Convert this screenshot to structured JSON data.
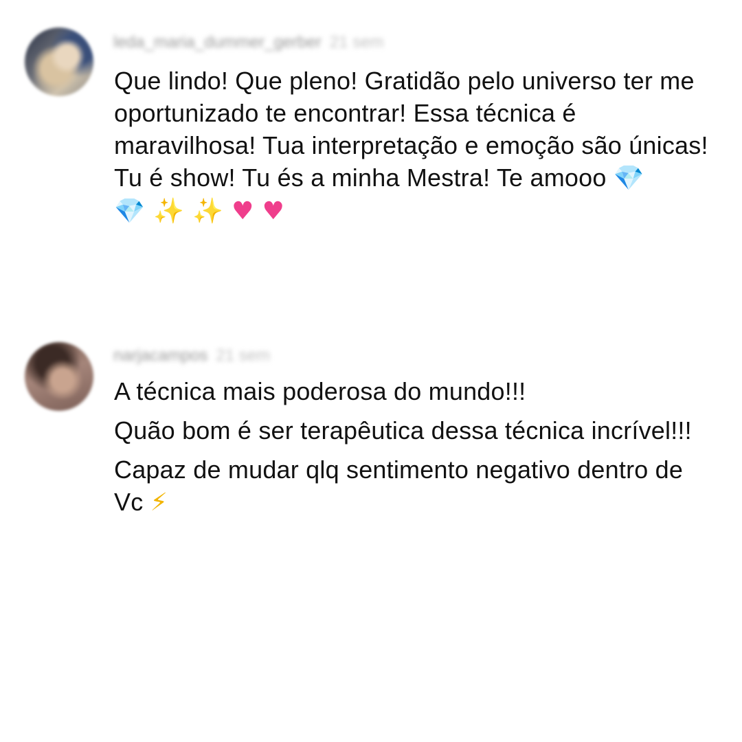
{
  "comments": [
    {
      "username": "leda_maria_dummer_gerber",
      "time": "21 sem",
      "text": "Que lindo! Que pleno! Gratidão pelo universo ter me oportunizado te encontrar! Essa técnica é maravilhosa! Tua interpretação e emoção são únicas! Tu é show! Tu és a minha Mestra! Te amooo",
      "emojis": [
        {
          "glyph": "💎",
          "icon": "gem-icon"
        },
        {
          "glyph": "💎",
          "icon": "gem-icon"
        },
        {
          "glyph": "✨",
          "icon": "sparkles-icon"
        },
        {
          "glyph": "✨",
          "icon": "sparkles-icon"
        },
        {
          "glyph": "♥",
          "icon": "pink-heart-icon"
        },
        {
          "glyph": "♥",
          "icon": "pink-heart-icon"
        }
      ]
    },
    {
      "username": "narjacampos",
      "time": "21 sem",
      "paragraphs": [
        "A técnica mais poderosa do mundo!!!",
        "Quão bom é ser terapêutica dessa técnica incrível!!!",
        "Capaz de mudar qlq sentimento negativo dentro de Vc"
      ],
      "emojis": [
        {
          "glyph": "⚡",
          "icon": "lightning-icon"
        }
      ]
    }
  ],
  "colors": {
    "text": "#111111",
    "meta": "#9a9a9a",
    "background": "#ffffff"
  }
}
